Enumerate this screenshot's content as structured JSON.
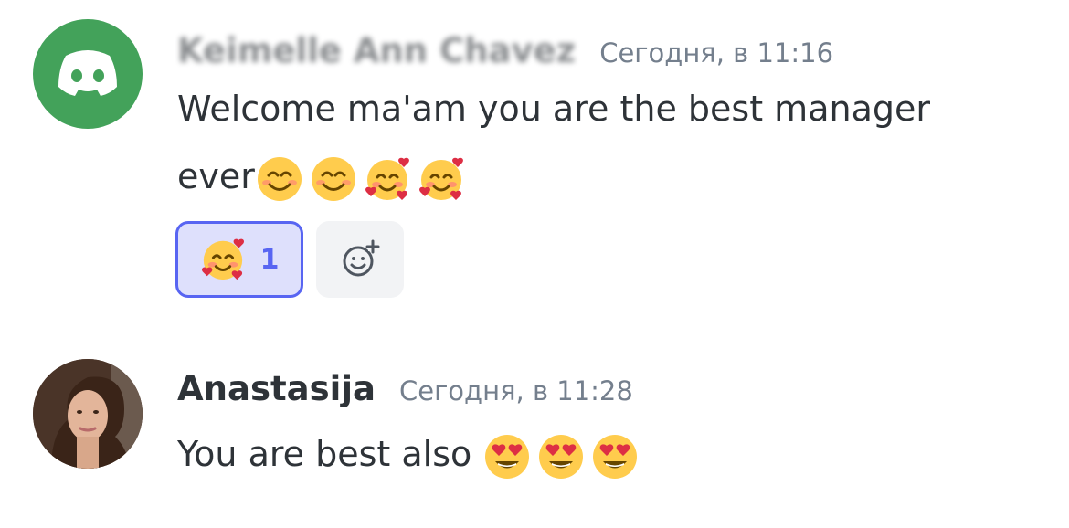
{
  "messages": [
    {
      "author": "Keimelle Ann Chavez",
      "author_visible_suffix": "z",
      "timestamp": "Сегодня, в 11:16",
      "text_line1": "Welcome ma'am  you are the best manager",
      "text_line2": "ever",
      "avatar_icon": "discord-logo-icon",
      "avatar_color": "#43a25a",
      "emojis": [
        "smiling-face-icon",
        "smiling-face-icon",
        "smiling-face-with-hearts-icon",
        "smiling-face-with-hearts-icon"
      ],
      "reactions": [
        {
          "emoji": "smiling-face-with-hearts-icon",
          "count": "1",
          "active": true
        }
      ],
      "add_reaction_icon": "add-reaction-icon"
    },
    {
      "author": "Anastasija",
      "timestamp": "Сегодня, в 11:28",
      "text": "You are best also",
      "avatar_icon": "user-photo",
      "emojis": [
        "heart-eyes-icon",
        "heart-eyes-icon",
        "heart-eyes-icon"
      ]
    }
  ],
  "colors": {
    "accent": "#5865f2",
    "reaction_bg": "#dee0fc",
    "timestamp": "#747f8d",
    "text": "#2e3338"
  }
}
